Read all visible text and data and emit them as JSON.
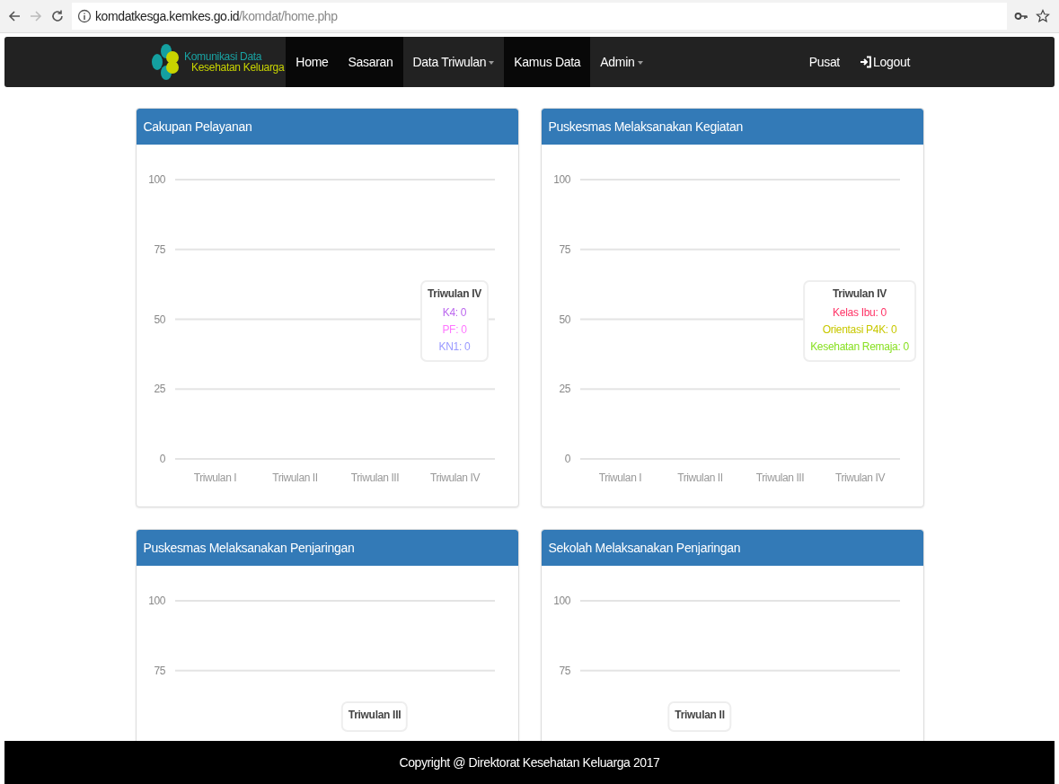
{
  "browser": {
    "url_host": "komdatkesga.kemkes.go.id",
    "url_path": "/komdat/home.php"
  },
  "navbar": {
    "brand": {
      "line1": "Komunikasi Data",
      "line2": "Kesehatan Keluarga"
    },
    "items": [
      {
        "label": "Home",
        "selected": true,
        "dropdown": false
      },
      {
        "label": "Sasaran",
        "selected": true,
        "dropdown": false
      },
      {
        "label": "Data Triwulan",
        "selected": false,
        "dropdown": true
      },
      {
        "label": "Kamus Data",
        "selected": true,
        "dropdown": false
      },
      {
        "label": "Admin",
        "selected": false,
        "dropdown": true
      }
    ],
    "right_items": [
      {
        "label": "Pusat",
        "kind": "text"
      },
      {
        "label": "Logout",
        "kind": "logout"
      }
    ]
  },
  "panels": [
    {
      "title": "Cakupan Pelayanan",
      "y_labels": [
        "100",
        "75",
        "50",
        "25",
        "0"
      ],
      "x_labels": [
        "Triwulan I",
        "Triwulan II",
        "Triwulan III",
        "Triwulan IV"
      ],
      "tooltip": {
        "title": "Triwulan IV",
        "entries": [
          {
            "text": "K4: 0",
            "color": "#bb66ee"
          },
          {
            "text": "PF: 0",
            "color": "#ff77ff"
          },
          {
            "text": "KN1: 0",
            "color": "#9999ff"
          }
        ]
      }
    },
    {
      "title": "Puskesmas Melaksanakan Kegiatan",
      "y_labels": [
        "100",
        "75",
        "50",
        "25",
        "0"
      ],
      "x_labels": [
        "Triwulan I",
        "Triwulan II",
        "Triwulan III",
        "Triwulan IV"
      ],
      "tooltip": {
        "title": "Triwulan IV",
        "entries": [
          {
            "text": "Kelas Ibu: 0",
            "color": "#ff3366"
          },
          {
            "text": "Orientasi P4K: 0",
            "color": "#c8c800"
          },
          {
            "text": "Kesehatan Remaja: 0",
            "color": "#88e022"
          }
        ]
      }
    },
    {
      "title": "Puskesmas Melaksanakan Penjaringan",
      "y_labels": [
        "100",
        "75"
      ],
      "tooltip": {
        "title": "Triwulan III"
      }
    },
    {
      "title": "Sekolah Melaksanakan Penjaringan",
      "y_labels": [
        "100",
        "75"
      ],
      "tooltip": {
        "title": "Triwulan II"
      }
    }
  ],
  "footer": {
    "text": "Copyright @ Direktorat Kesehatan Keluarga 2017"
  }
}
